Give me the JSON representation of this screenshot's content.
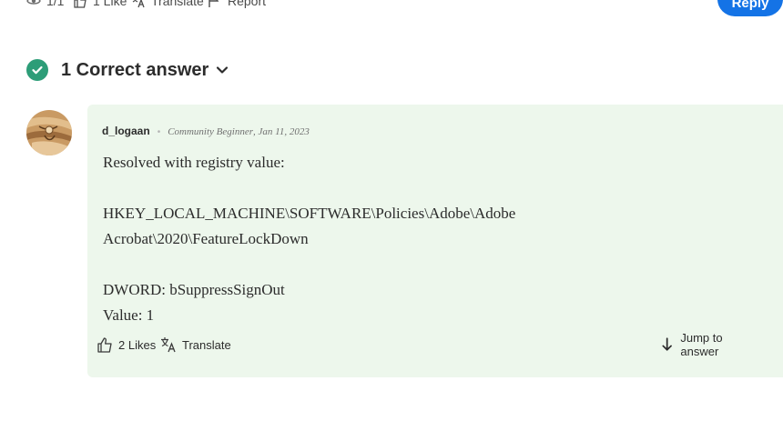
{
  "top_bar": {
    "views_count": "1/1",
    "like_label": "1 Like",
    "translate_label": "Translate",
    "report_label": "Report",
    "reply_label": "Reply"
  },
  "correct_answer": {
    "title": "1 Correct answer"
  },
  "post": {
    "author": "d_logaan",
    "rank": "Community Beginner",
    "date": ", Jan 11, 2023",
    "lines": [
      "Resolved with registry value:",
      "",
      "HKEY_LOCAL_MACHINE\\SOFTWARE\\Policies\\Adobe\\Adobe",
      "Acrobat\\2020\\FeatureLockDown",
      "",
      "DWORD: bSuppressSignOut",
      "Value: 1"
    ],
    "likes_label": "2 Likes",
    "translate_label": "Translate",
    "jump_label": "Jump to answer"
  },
  "colors": {
    "accent_blue": "#1473e6",
    "check_green": "#2d9d78",
    "card_bg": "#edf7ec"
  }
}
